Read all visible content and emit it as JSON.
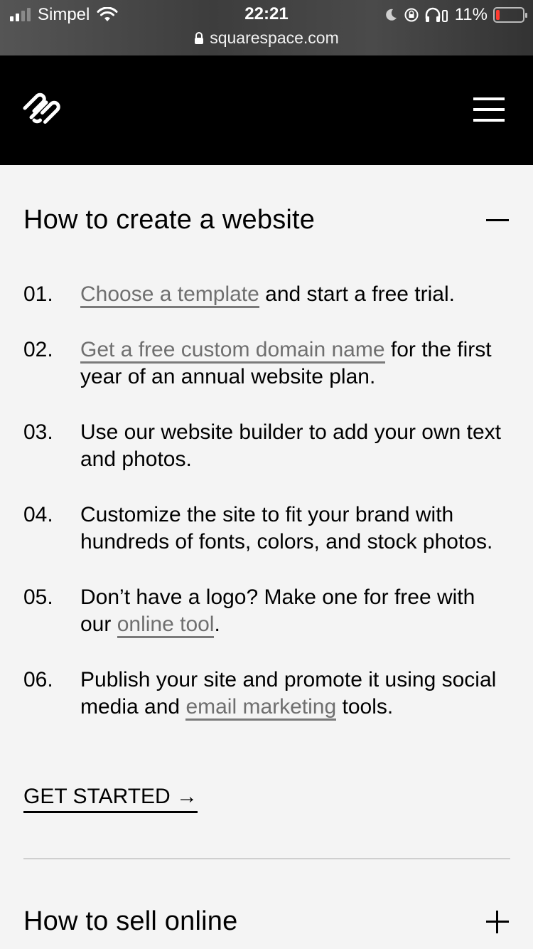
{
  "status_bar": {
    "carrier": "Simpel",
    "time": "22:21",
    "url": "squarespace.com",
    "battery": "11%",
    "battery_color": "#ff3b30"
  },
  "header": {
    "logo_icon": "squarespace-logo-icon",
    "menu_icon": "hamburger-menu-icon"
  },
  "section1": {
    "title": "How to create a website",
    "toggle_icon": "minus-icon",
    "steps": [
      {
        "num": "01.",
        "link": "Choose a template",
        "after": " and start a free trial."
      },
      {
        "num": "02.",
        "link": "Get a free custom domain name",
        "after": " for the first year of an annual website plan."
      },
      {
        "num": "03.",
        "text": "Use our website builder to add your own text and photos."
      },
      {
        "num": "04.",
        "text": "Customize the site to fit your brand with hundreds of fonts, colors, and stock photos."
      },
      {
        "num": "05.",
        "before": "Don’t have a logo? Make one for free with our ",
        "link": "online tool",
        "after": "."
      },
      {
        "num": "06.",
        "before": "Publish your site and promote it using social media and ",
        "link": "email marketing",
        "after": " tools."
      }
    ],
    "cta": "GET STARTED →"
  },
  "section2": {
    "title": "How to sell online",
    "toggle_icon": "plus-icon"
  }
}
